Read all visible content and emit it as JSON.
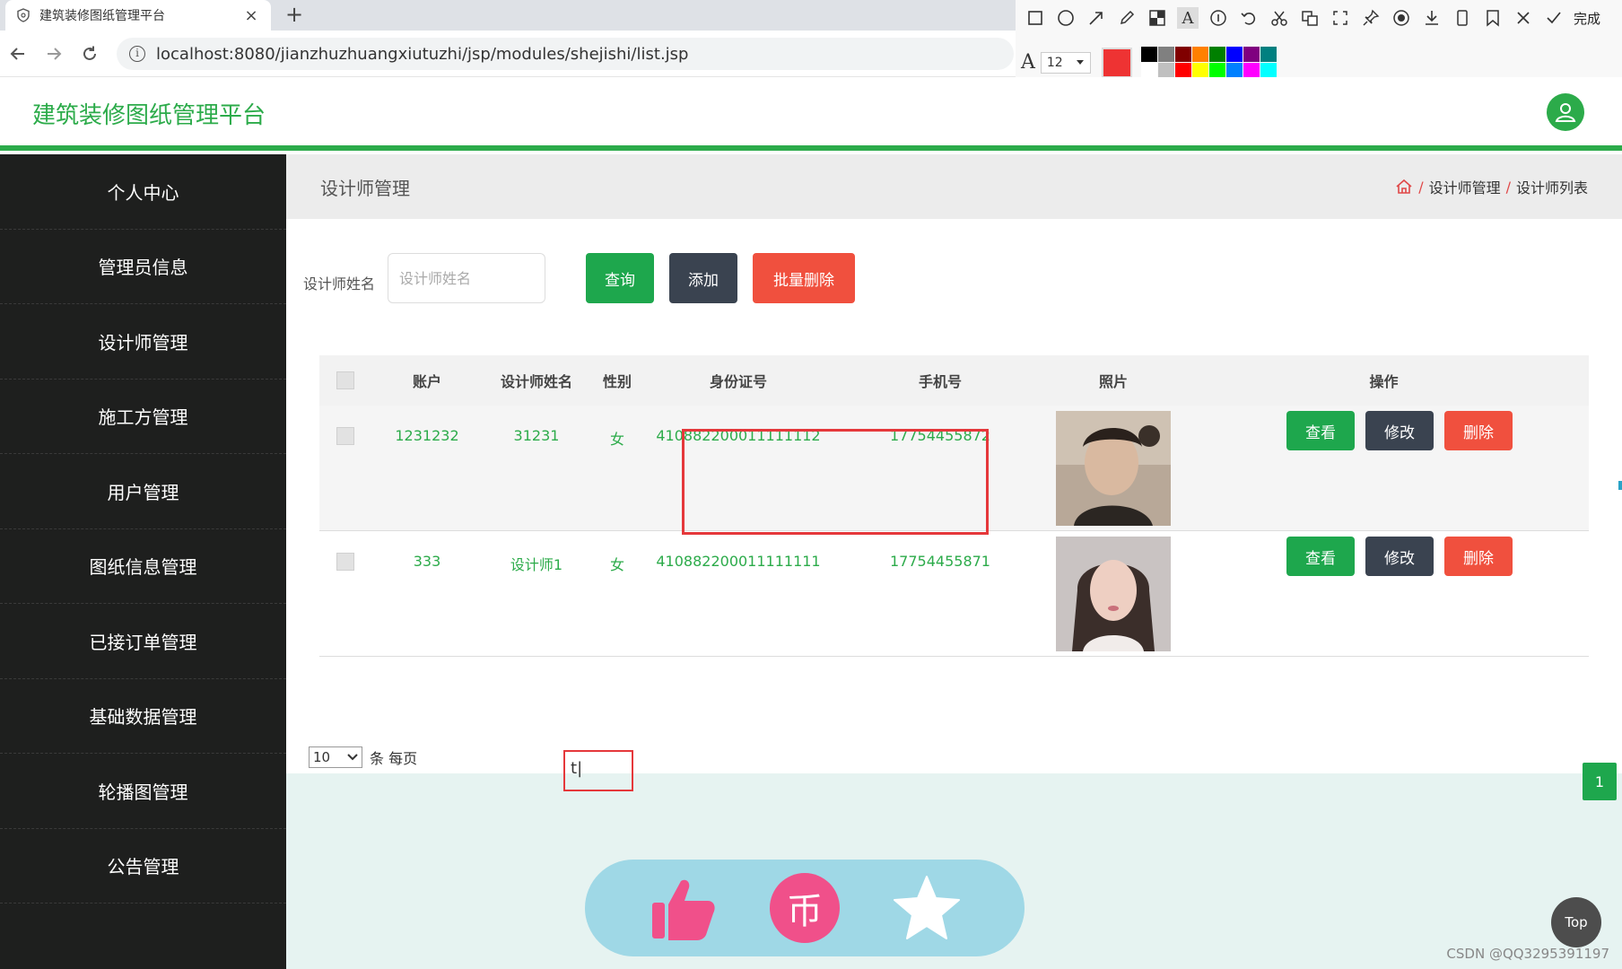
{
  "browser": {
    "tab_title": "建筑装修图纸管理平台",
    "tab_close": "×",
    "new_tab": "+",
    "url": "localhost:8080/jianzhuzhuangxiutuzhi/jsp/modules/shejishi/list.jsp"
  },
  "annotation_toolbar": {
    "done_label": "完成",
    "font_size": "12",
    "current_color": "#ee3333",
    "palette_colors": [
      "#000000",
      "#808080",
      "#800000",
      "#ff8000",
      "#008000",
      "#0000ff",
      "#800080",
      "#008080",
      "#ffffff",
      "#c0c0c0",
      "#ff0000",
      "#ffff00",
      "#00ff00",
      "#0080ff",
      "#ff00ff",
      "#00ffff"
    ]
  },
  "app": {
    "title": "建筑装修图纸管理平台",
    "accent_color": "#2cab4a"
  },
  "sidebar": {
    "items": [
      {
        "label": "个人中心"
      },
      {
        "label": "管理员信息"
      },
      {
        "label": "设计师管理"
      },
      {
        "label": "施工方管理"
      },
      {
        "label": "用户管理"
      },
      {
        "label": "图纸信息管理"
      },
      {
        "label": "已接订单管理"
      },
      {
        "label": "基础数据管理"
      },
      {
        "label": "轮播图管理"
      },
      {
        "label": "公告管理"
      }
    ]
  },
  "page": {
    "title": "设计师管理",
    "breadcrumb": {
      "sep1": "/",
      "item1": "设计师管理",
      "sep2": "/",
      "item2": "设计师列表"
    }
  },
  "search": {
    "label": "设计师姓名",
    "placeholder": "设计师姓名",
    "value": ""
  },
  "actions": {
    "query": "查询",
    "add": "添加",
    "batch_delete": "批量删除"
  },
  "table": {
    "headers": {
      "account": "账户",
      "name": "设计师姓名",
      "sex": "性别",
      "id_card": "身份证号",
      "phone": "手机号",
      "photo": "照片",
      "ops": "操作"
    },
    "rows": [
      {
        "account": "1231232",
        "name": "31231",
        "sex": "女",
        "id_card": "410882200011111112",
        "phone": "17754455872"
      },
      {
        "account": "333",
        "name": "设计师1",
        "sex": "女",
        "id_card": "410882200011111111",
        "phone": "17754455871"
      }
    ],
    "op_labels": {
      "view": "查看",
      "edit": "修改",
      "delete": "删除"
    }
  },
  "pagination": {
    "page_size": "10",
    "per_page_label": "条 每页",
    "current_page": "1",
    "typed_text": "t"
  },
  "floating": {
    "top_label": "Top",
    "coin_glyph": "币"
  },
  "watermark": "CSDN @QQ3295391197"
}
